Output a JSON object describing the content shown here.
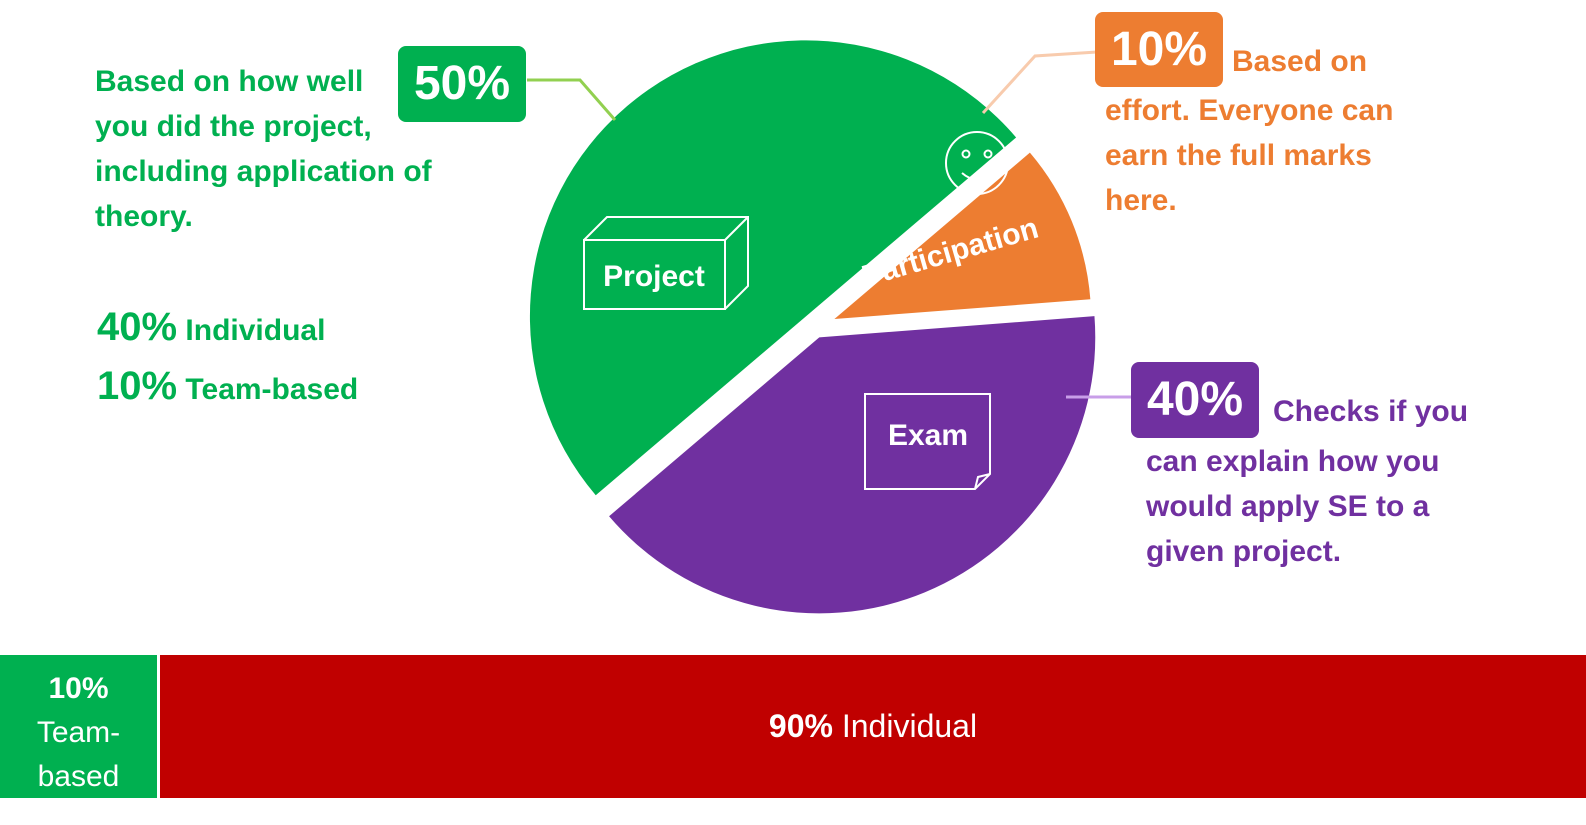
{
  "chart_data": {
    "type": "pie",
    "slices": [
      {
        "label": "Project",
        "value": 50,
        "value_label": "50%",
        "color": "#00b050"
      },
      {
        "label": "Participation",
        "value": 10,
        "value_label": "10%",
        "color": "#ed7d31"
      },
      {
        "label": "Exam",
        "value": 40,
        "value_label": "40%",
        "color": "#7030a0"
      }
    ]
  },
  "descriptions": {
    "project": [
      "Based on how well",
      "you did the project,",
      "including application of",
      "theory."
    ],
    "participation_first": "Based on",
    "participation_rest": [
      "effort. Everyone can",
      "earn the full marks",
      "here."
    ],
    "exam_first": "Checks if you",
    "exam_rest": [
      "can explain how you",
      "would apply SE to a",
      "given project."
    ]
  },
  "project_split": [
    {
      "percent": "40%",
      "label": "Individual"
    },
    {
      "percent": "10%",
      "label": "Team-based"
    }
  ],
  "bottom_bar": {
    "team": {
      "percent": "10%",
      "label_line1": "Team-",
      "label_line2": "based",
      "value": 10,
      "color": "#00b050"
    },
    "individual": {
      "percent": "90%",
      "label": "Individual",
      "value": 90,
      "color": "#c00000"
    }
  },
  "colors": {
    "project": "#00b050",
    "participation": "#ed7d31",
    "exam": "#7030a0",
    "individual": "#c00000"
  }
}
